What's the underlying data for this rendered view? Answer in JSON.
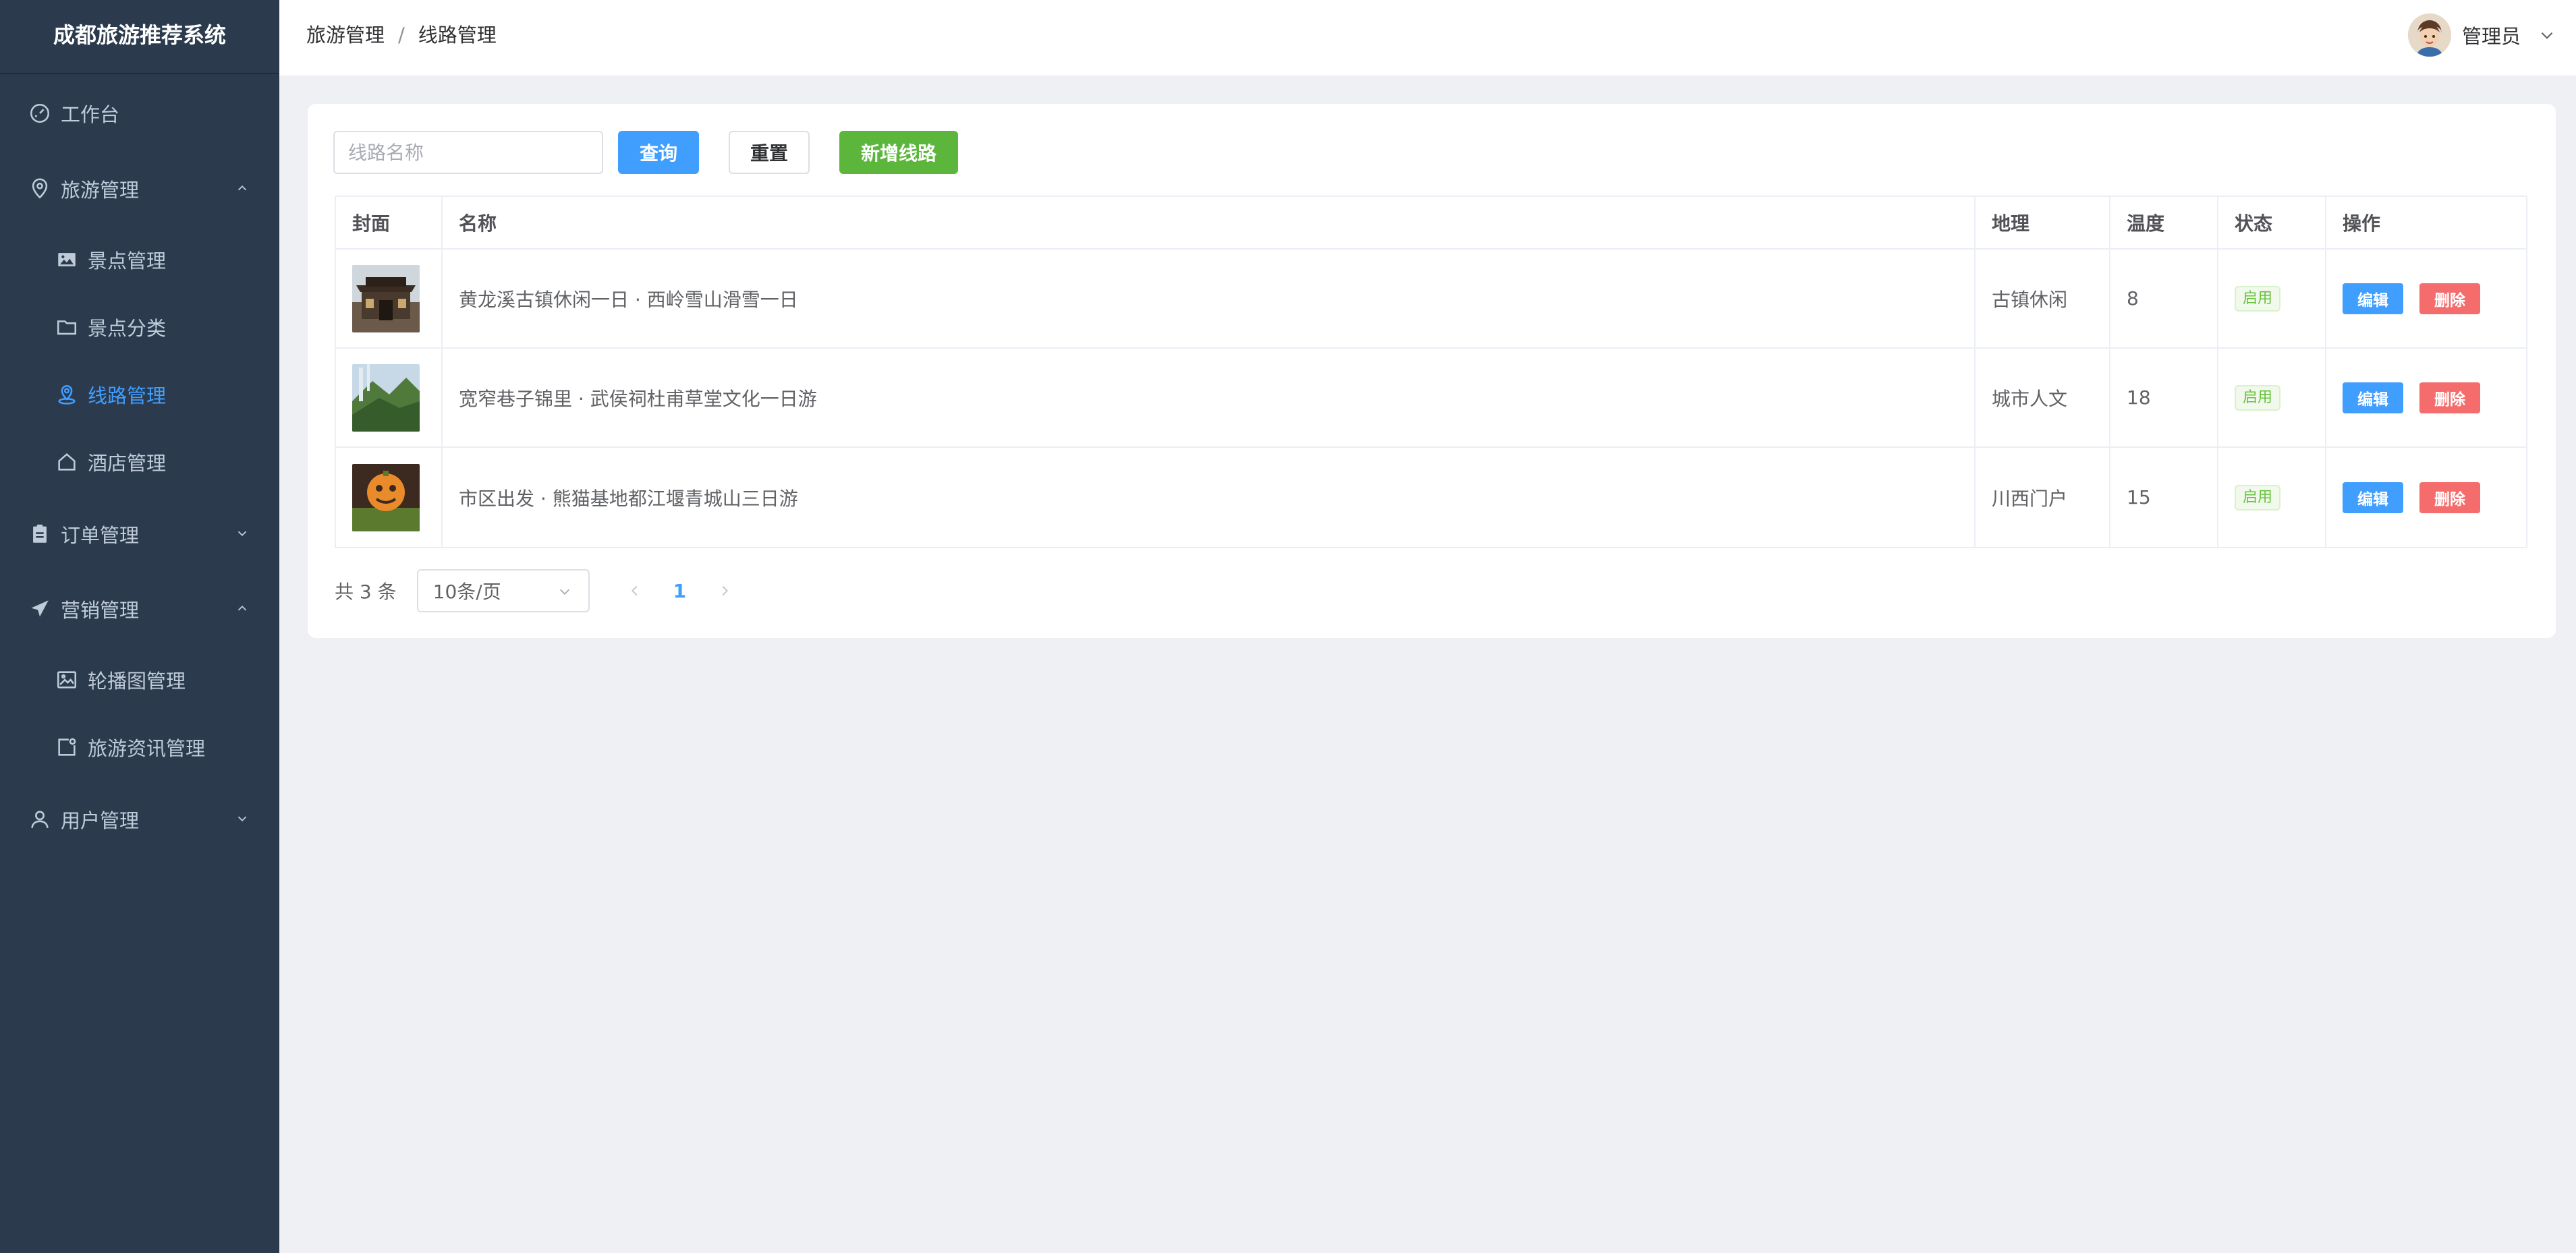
{
  "app": {
    "title": "成都旅游推荐系统"
  },
  "sidebar": {
    "items": [
      {
        "label": "工作台",
        "icon": "dashboard-icon"
      },
      {
        "label": "旅游管理",
        "icon": "location-icon",
        "expanded": true
      },
      {
        "label": "景点管理",
        "icon": "picture-icon"
      },
      {
        "label": "景点分类",
        "icon": "folder-icon"
      },
      {
        "label": "线路管理",
        "icon": "route-location-icon",
        "active": true
      },
      {
        "label": "酒店管理",
        "icon": "house-icon"
      },
      {
        "label": "订单管理",
        "icon": "clipboard-icon",
        "expanded": false
      },
      {
        "label": "营销管理",
        "icon": "promotion-icon",
        "expanded": true
      },
      {
        "label": "轮播图管理",
        "icon": "image-icon"
      },
      {
        "label": "旅游资讯管理",
        "icon": "news-icon"
      },
      {
        "label": "用户管理",
        "icon": "user-icon",
        "expanded": false
      }
    ]
  },
  "header": {
    "breadcrumb": [
      "旅游管理",
      "线路管理"
    ],
    "separator": "/",
    "user_name": "管理员"
  },
  "toolbar": {
    "search_placeholder": "线路名称",
    "query_label": "查询",
    "reset_label": "重置",
    "add_label": "新增线路"
  },
  "table": {
    "columns": [
      "封面",
      "名称",
      "地理",
      "温度",
      "状态",
      "操作"
    ],
    "rows": [
      {
        "name": "黄龙溪古镇休闲一日 · 西岭雪山滑雪一日",
        "geo": "古镇休闲",
        "temp": "8",
        "status": "启用"
      },
      {
        "name": "宽窄巷子锦里 · 武侯祠杜甫草堂文化一日游",
        "geo": "城市人文",
        "temp": "18",
        "status": "启用"
      },
      {
        "name": "市区出发 · 熊猫基地都江堰青城山三日游",
        "geo": "川西门户",
        "temp": "15",
        "status": "启用"
      }
    ],
    "edit_label": "编辑",
    "delete_label": "删除"
  },
  "pagination": {
    "total_text": "共 3 条",
    "page_size": "10条/页",
    "current_page": "1"
  },
  "colors": {
    "sidebar_bg": "#2b3a4d",
    "primary": "#409eff",
    "success": "#5cb63b",
    "danger": "#f56c6c"
  }
}
